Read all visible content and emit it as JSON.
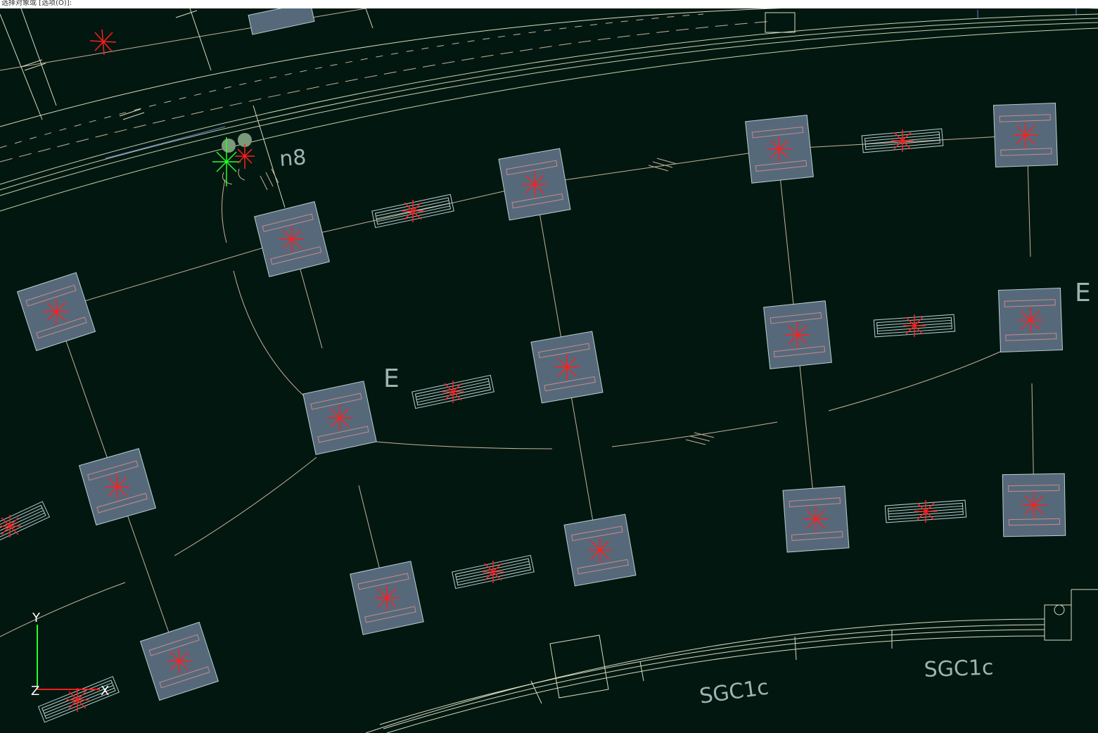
{
  "command_line": {
    "text": "选择对象或 [选项(O)]:"
  },
  "colors": {
    "background": "#021710",
    "pier_fill": "#56697a",
    "pier_stroke": "#b8cfd0",
    "marker_red": "#ff1e1e",
    "line_tan": "#c7b19b",
    "line_pale": "#d8dcc0",
    "label": "#9fb3b0",
    "gizmo_green": "#27ff27"
  },
  "labels": {
    "n8": "n8",
    "e1": "E",
    "e2": "E",
    "sgc1": "SGC1c",
    "sgc2": "SGC1c"
  },
  "ucs": {
    "y": "Y",
    "x": "X",
    "z": "Z"
  }
}
